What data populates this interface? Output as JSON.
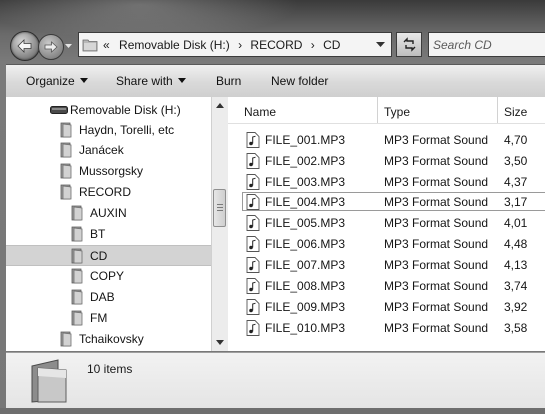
{
  "navigation": {
    "breadcrumb_overflow": "«",
    "breadcrumbs": [
      "Removable Disk (H:)",
      "RECORD",
      "CD"
    ],
    "separator": "›"
  },
  "search": {
    "placeholder": "Search CD"
  },
  "toolbar": {
    "organize_label": "Organize",
    "share_label": "Share with",
    "burn_label": "Burn",
    "new_folder_label": "New folder"
  },
  "tree": {
    "items": [
      {
        "label": "Removable Disk (H:)",
        "icon": "drive-icon",
        "level": 0
      },
      {
        "label": "Haydn, Torelli, etc",
        "icon": "folder-icon",
        "level": 1
      },
      {
        "label": "Janácek",
        "icon": "folder-icon",
        "level": 1
      },
      {
        "label": "Mussorgsky",
        "icon": "folder-icon",
        "level": 1
      },
      {
        "label": "RECORD",
        "icon": "folder-icon",
        "level": 1
      },
      {
        "label": "AUXIN",
        "icon": "folder-icon",
        "level": 2
      },
      {
        "label": "BT",
        "icon": "folder-icon",
        "level": 2
      },
      {
        "label": "CD",
        "icon": "folder-icon",
        "level": 2,
        "selected": true
      },
      {
        "label": "COPY",
        "icon": "folder-icon",
        "level": 2
      },
      {
        "label": "DAB",
        "icon": "folder-icon",
        "level": 2
      },
      {
        "label": "FM",
        "icon": "folder-icon",
        "level": 2
      },
      {
        "label": "Tchaikovsky",
        "icon": "folder-icon",
        "level": 1
      }
    ]
  },
  "columns": {
    "name": "Name",
    "type": "Type",
    "size": "Size"
  },
  "files": [
    {
      "name": "FILE_001.MP3",
      "type": "MP3 Format Sound",
      "size": "4,70"
    },
    {
      "name": "FILE_002.MP3",
      "type": "MP3 Format Sound",
      "size": "3,50"
    },
    {
      "name": "FILE_003.MP3",
      "type": "MP3 Format Sound",
      "size": "4,37"
    },
    {
      "name": "FILE_004.MP3",
      "type": "MP3 Format Sound",
      "size": "3,17",
      "focused": true
    },
    {
      "name": "FILE_005.MP3",
      "type": "MP3 Format Sound",
      "size": "4,01"
    },
    {
      "name": "FILE_006.MP3",
      "type": "MP3 Format Sound",
      "size": "4,48"
    },
    {
      "name": "FILE_007.MP3",
      "type": "MP3 Format Sound",
      "size": "4,13"
    },
    {
      "name": "FILE_008.MP3",
      "type": "MP3 Format Sound",
      "size": "3,74"
    },
    {
      "name": "FILE_009.MP3",
      "type": "MP3 Format Sound",
      "size": "3,92"
    },
    {
      "name": "FILE_010.MP3",
      "type": "MP3 Format Sound",
      "size": "3,58"
    }
  ],
  "details": {
    "item_count": "10 items"
  },
  "icons": {
    "back": "back-arrow-icon",
    "forward": "forward-arrow-icon",
    "refresh": "refresh-icon",
    "file": "audio-file-icon",
    "folder": "folder-icon",
    "drive": "drive-icon"
  }
}
